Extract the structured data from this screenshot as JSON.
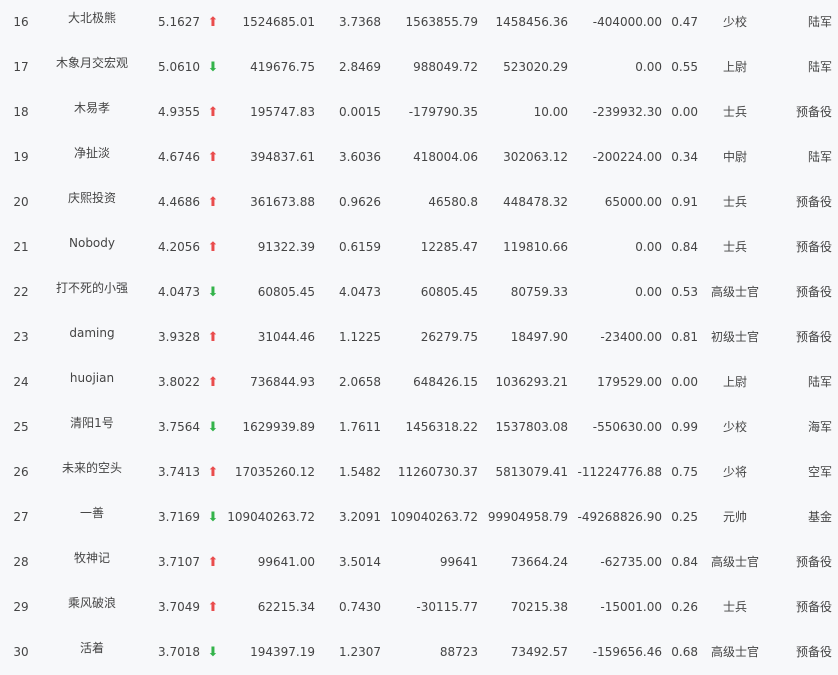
{
  "rows": [
    {
      "rank": "16",
      "name": "大北极熊",
      "value": "5.1627",
      "trend": "up",
      "total": "1524685.01",
      "ratio": "3.7368",
      "a": "1563855.79",
      "b": "1458456.36",
      "c": "-404000.00",
      "d": "0.47",
      "title": "少校",
      "branch": "陆军"
    },
    {
      "rank": "17",
      "name": "木象月交宏观",
      "value": "5.0610",
      "trend": "down",
      "total": "419676.75",
      "ratio": "2.8469",
      "a": "988049.72",
      "b": "523020.29",
      "c": "0.00",
      "d": "0.55",
      "title": "上尉",
      "branch": "陆军"
    },
    {
      "rank": "18",
      "name": "木易孝",
      "value": "4.9355",
      "trend": "up",
      "total": "195747.83",
      "ratio": "0.0015",
      "a": "-179790.35",
      "b": "10.00",
      "c": "-239932.30",
      "d": "0.00",
      "title": "士兵",
      "branch": "预备役"
    },
    {
      "rank": "19",
      "name": "净扯淡",
      "value": "4.6746",
      "trend": "up",
      "total": "394837.61",
      "ratio": "3.6036",
      "a": "418004.06",
      "b": "302063.12",
      "c": "-200224.00",
      "d": "0.34",
      "title": "中尉",
      "branch": "陆军"
    },
    {
      "rank": "20",
      "name": "庆熙投资",
      "value": "4.4686",
      "trend": "up",
      "total": "361673.88",
      "ratio": "0.9626",
      "a": "46580.8",
      "b": "448478.32",
      "c": "65000.00",
      "d": "0.91",
      "title": "士兵",
      "branch": "预备役"
    },
    {
      "rank": "21",
      "name": "Nobody",
      "value": "4.2056",
      "trend": "up",
      "total": "91322.39",
      "ratio": "0.6159",
      "a": "12285.47",
      "b": "119810.66",
      "c": "0.00",
      "d": "0.84",
      "title": "士兵",
      "branch": "预备役"
    },
    {
      "rank": "22",
      "name": "打不死的小强",
      "value": "4.0473",
      "trend": "down",
      "total": "60805.45",
      "ratio": "4.0473",
      "a": "60805.45",
      "b": "80759.33",
      "c": "0.00",
      "d": "0.53",
      "title": "高级士官",
      "branch": "预备役"
    },
    {
      "rank": "23",
      "name": "daming",
      "value": "3.9328",
      "trend": "up",
      "total": "31044.46",
      "ratio": "1.1225",
      "a": "26279.75",
      "b": "18497.90",
      "c": "-23400.00",
      "d": "0.81",
      "title": "初级士官",
      "branch": "预备役"
    },
    {
      "rank": "24",
      "name": "huojian",
      "value": "3.8022",
      "trend": "up",
      "total": "736844.93",
      "ratio": "2.0658",
      "a": "648426.15",
      "b": "1036293.21",
      "c": "179529.00",
      "d": "0.00",
      "title": "上尉",
      "branch": "陆军"
    },
    {
      "rank": "25",
      "name": "清阳1号",
      "value": "3.7564",
      "trend": "down",
      "total": "1629939.89",
      "ratio": "1.7611",
      "a": "1456318.22",
      "b": "1537803.08",
      "c": "-550630.00",
      "d": "0.99",
      "title": "少校",
      "branch": "海军"
    },
    {
      "rank": "26",
      "name": "未来的空头",
      "value": "3.7413",
      "trend": "up",
      "total": "17035260.12",
      "ratio": "1.5482",
      "a": "11260730.37",
      "b": "5813079.41",
      "c": "-11224776.88",
      "d": "0.75",
      "title": "少将",
      "branch": "空军"
    },
    {
      "rank": "27",
      "name": "一善",
      "value": "3.7169",
      "trend": "down",
      "total": "109040263.72",
      "ratio": "3.2091",
      "a": "109040263.72",
      "b": "99904958.79",
      "c": "-49268826.90",
      "d": "0.25",
      "title": "元帅",
      "branch": "基金"
    },
    {
      "rank": "28",
      "name": "牧神记",
      "value": "3.7107",
      "trend": "up",
      "total": "99641.00",
      "ratio": "3.5014",
      "a": "99641",
      "b": "73664.24",
      "c": "-62735.00",
      "d": "0.84",
      "title": "高级士官",
      "branch": "预备役"
    },
    {
      "rank": "29",
      "name": "乘风破浪",
      "value": "3.7049",
      "trend": "up",
      "total": "62215.34",
      "ratio": "0.7430",
      "a": "-30115.77",
      "b": "70215.38",
      "c": "-15001.00",
      "d": "0.26",
      "title": "士兵",
      "branch": "预备役"
    },
    {
      "rank": "30",
      "name": "活着",
      "value": "3.7018",
      "trend": "down",
      "total": "194397.19",
      "ratio": "1.2307",
      "a": "88723",
      "b": "73492.57",
      "c": "-159656.46",
      "d": "0.68",
      "title": "高级士官",
      "branch": "预备役"
    }
  ],
  "arrows": {
    "up": "⬆",
    "down": "⬇"
  },
  "colors": {
    "up": "#e94c4c",
    "down": "#33b34a",
    "text": "#444444",
    "background": "#f7f8fa"
  }
}
